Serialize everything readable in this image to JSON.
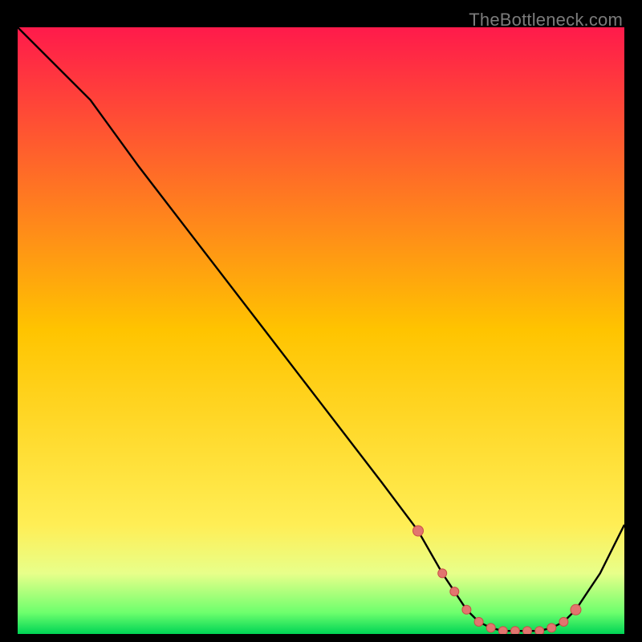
{
  "watermark": "TheBottleneck.com",
  "colors": {
    "top": "#ff1a4b",
    "mid": "#ffd400",
    "green_band_top": "#e8ff8a",
    "green_band_bottom": "#00e05a",
    "curve": "#000000",
    "marker_fill": "#e2756f",
    "marker_stroke": "#c94f48"
  },
  "chart_data": {
    "type": "line",
    "title": "",
    "xlabel": "",
    "ylabel": "",
    "xlim": [
      0,
      100
    ],
    "ylim": [
      0,
      100
    ],
    "grid": false,
    "legend": false,
    "series": [
      {
        "name": "bottleneck-curve",
        "x": [
          0,
          8,
          12,
          20,
          30,
          40,
          50,
          60,
          66,
          70,
          72,
          74,
          76,
          78,
          80,
          82,
          84,
          86,
          88,
          90,
          92,
          94,
          96,
          100
        ],
        "y": [
          100,
          92,
          88,
          77,
          64,
          51,
          38,
          25,
          17,
          10,
          7,
          4,
          2,
          1,
          0.5,
          0.5,
          0.5,
          0.5,
          1,
          2,
          4,
          7,
          10,
          18
        ]
      }
    ],
    "markers": {
      "name": "highlighted-points",
      "x": [
        66,
        70,
        72,
        74,
        76,
        78,
        80,
        82,
        84,
        86,
        88,
        90,
        92
      ],
      "y": [
        17,
        10,
        7,
        4,
        2,
        1,
        0.5,
        0.5,
        0.5,
        0.5,
        1,
        2,
        4
      ]
    },
    "gradient_bands": [
      {
        "stop": 0.0,
        "color": "#ff1a4b"
      },
      {
        "stop": 0.5,
        "color": "#ffc400"
      },
      {
        "stop": 0.82,
        "color": "#ffee55"
      },
      {
        "stop": 0.9,
        "color": "#e8ff8a"
      },
      {
        "stop": 0.965,
        "color": "#6dff6d"
      },
      {
        "stop": 1.0,
        "color": "#00d455"
      }
    ]
  }
}
